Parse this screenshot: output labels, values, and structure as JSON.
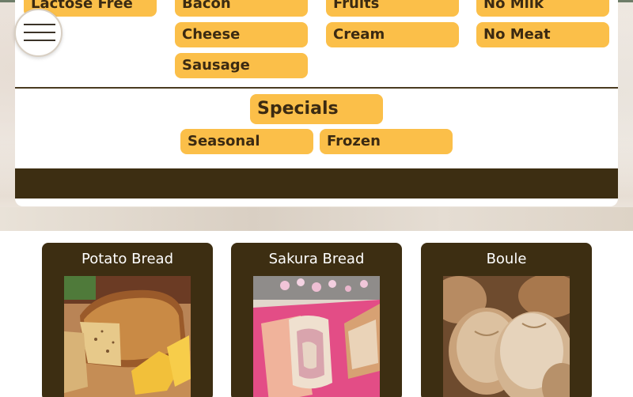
{
  "filters": {
    "row1": [
      "Lactose Free",
      "Bacon",
      "Fruits",
      "No Milk"
    ],
    "row2": [
      "Cheese",
      "Cream",
      "No Meat"
    ],
    "row3": [
      "Sausage"
    ]
  },
  "specials": {
    "heading": "Specials",
    "items": [
      "Seasonal",
      "Frozen"
    ]
  },
  "breads": [
    {
      "name": "Potato Bread"
    },
    {
      "name": "Sakura Bread"
    },
    {
      "name": "Boule"
    }
  ],
  "icons": {
    "menu": "hamburger-menu-icon"
  },
  "colors": {
    "pill": "#fbbf49",
    "dark_brown": "#3d2e12",
    "pill_text": "#3b2a12"
  }
}
